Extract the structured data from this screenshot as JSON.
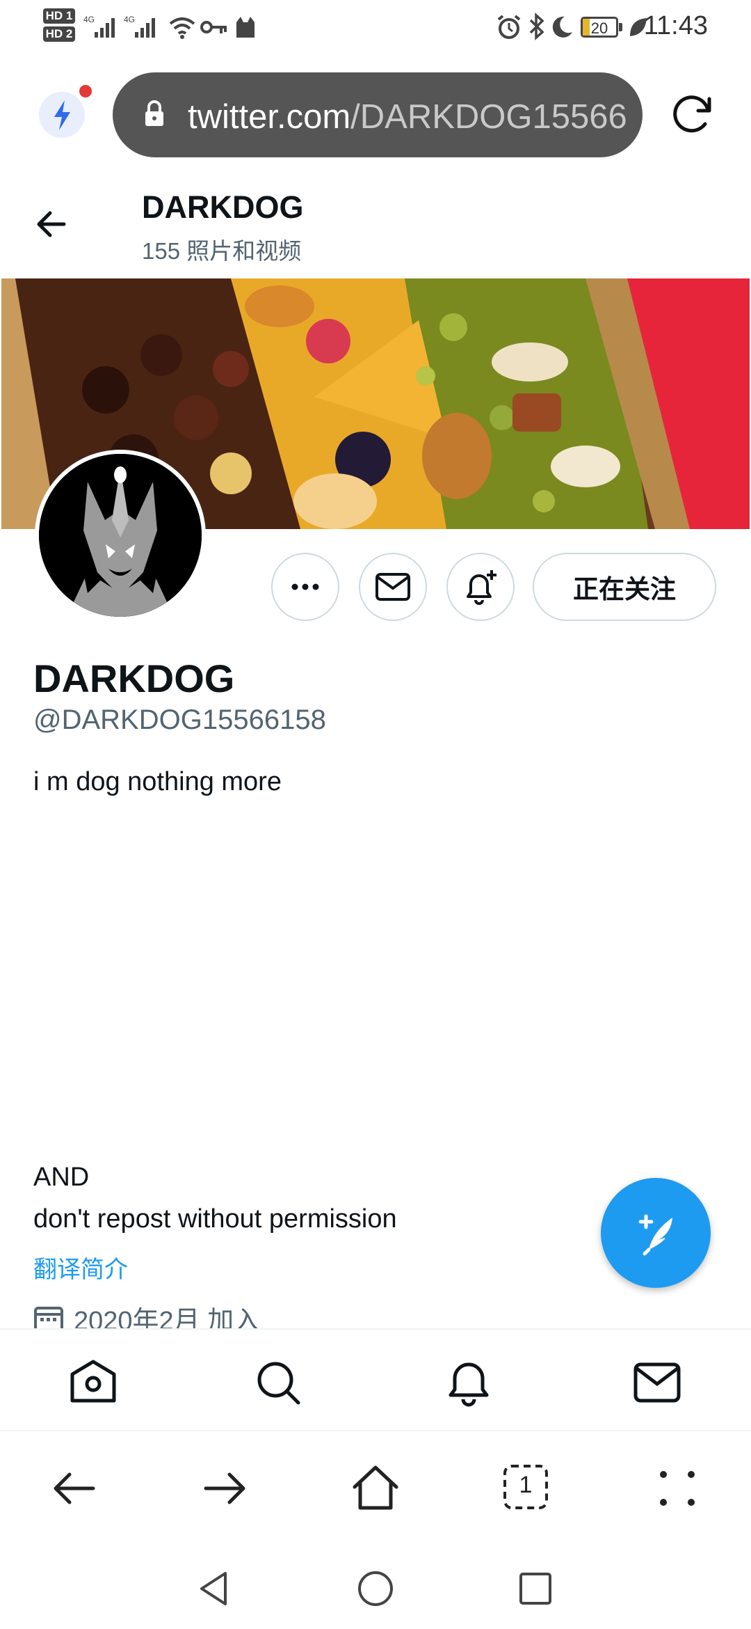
{
  "status_bar": {
    "sim1": "HD 1",
    "sim2": "HD 2",
    "net1": "4G",
    "net2": "4G",
    "battery": "20",
    "time": "11:43"
  },
  "browser": {
    "url_host": "twitter.com",
    "url_path": "/DARKDOG15566"
  },
  "header": {
    "name": "DARKDOG",
    "subtitle": "155 照片和视频"
  },
  "profile": {
    "display_name": "DARKDOG",
    "handle": "@DARKDOG15566158",
    "bio_line1": "i m dog nothing more",
    "bio_line2": "AND",
    "bio_line3": "don't repost without permission",
    "translate_label": "翻译简介",
    "joined": "2020年2月 加入",
    "follow_label": "正在关注"
  },
  "colors": {
    "accent": "#1d9bf0",
    "text_secondary": "#536471",
    "url_bar": "#555555"
  },
  "icons": {
    "back": "arrow-left-icon",
    "more": "more-icon",
    "message": "mail-icon",
    "notify": "bell-plus-icon",
    "compose": "compose-feather-icon",
    "tabs": [
      "home-icon",
      "search-icon",
      "bell-icon",
      "mail-icon"
    ],
    "browser": [
      "back-icon",
      "forward-icon",
      "home-icon",
      "tabs-icon",
      "menu-icon"
    ],
    "system": [
      "nav-back-icon",
      "nav-home-icon",
      "nav-recents-icon"
    ]
  },
  "browser_tabs_count": "1"
}
